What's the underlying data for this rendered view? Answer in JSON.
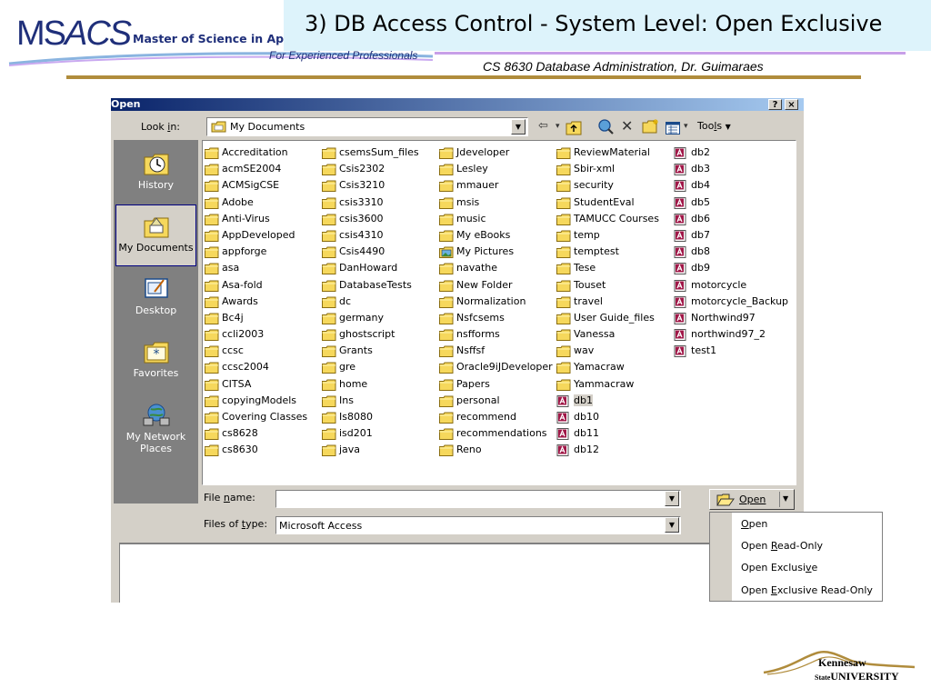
{
  "logo": {
    "ms": "MS",
    "acs": "ACS",
    "subtitle": "Master of Science in App",
    "tagline": "For Experienced Professionals"
  },
  "slide": {
    "title": "3) DB Access Control - System Level: Open Exclusive",
    "course": "CS 8630 Database Administration, Dr. Guimaraes",
    "footer_logo_line1": "Kennesaw",
    "footer_logo_line2a": "State",
    "footer_logo_line2b": "UNIVERSITY"
  },
  "dialog": {
    "title": "Open",
    "help_btn": "?",
    "close_btn": "×",
    "look_in_label_pre": "Look ",
    "look_in_label_u": "i",
    "look_in_label_post": "n:",
    "look_in_value": "My Documents",
    "tools_pre": "Too",
    "tools_u": "l",
    "tools_post": "s",
    "places": [
      {
        "label": "History",
        "icon": "history-icon"
      },
      {
        "label": "My Documents",
        "icon": "my-documents-icon",
        "selected": true
      },
      {
        "label": "Desktop",
        "icon": "desktop-icon"
      },
      {
        "label": "Favorites",
        "icon": "favorites-icon"
      },
      {
        "label": "My Network Places",
        "icon": "network-places-icon"
      }
    ],
    "columns": [
      [
        {
          "name": "Accreditation",
          "type": "folder"
        },
        {
          "name": "acmSE2004",
          "type": "folder"
        },
        {
          "name": "ACMSigCSE",
          "type": "folder"
        },
        {
          "name": "Adobe",
          "type": "folder"
        },
        {
          "name": "Anti-Virus",
          "type": "folder"
        },
        {
          "name": "AppDeveloped",
          "type": "folder"
        },
        {
          "name": "appforge",
          "type": "folder"
        },
        {
          "name": "asa",
          "type": "folder"
        },
        {
          "name": "Asa-fold",
          "type": "folder"
        },
        {
          "name": "Awards",
          "type": "folder"
        },
        {
          "name": "Bc4j",
          "type": "folder"
        },
        {
          "name": "ccli2003",
          "type": "folder"
        },
        {
          "name": "ccsc",
          "type": "folder"
        },
        {
          "name": "ccsc2004",
          "type": "folder"
        },
        {
          "name": "CITSA",
          "type": "folder"
        },
        {
          "name": "copyingModels",
          "type": "folder"
        },
        {
          "name": "Covering Classes",
          "type": "folder"
        },
        {
          "name": "cs8628",
          "type": "folder"
        },
        {
          "name": "cs8630",
          "type": "folder"
        }
      ],
      [
        {
          "name": "csemsSum_files",
          "type": "folder"
        },
        {
          "name": "Csis2302",
          "type": "folder"
        },
        {
          "name": "Csis3210",
          "type": "folder"
        },
        {
          "name": "csis3310",
          "type": "folder"
        },
        {
          "name": "csis3600",
          "type": "folder"
        },
        {
          "name": "csis4310",
          "type": "folder"
        },
        {
          "name": "Csis4490",
          "type": "folder"
        },
        {
          "name": "DanHoward",
          "type": "folder"
        },
        {
          "name": "DatabaseTests",
          "type": "folder"
        },
        {
          "name": "dc",
          "type": "folder"
        },
        {
          "name": "germany",
          "type": "folder"
        },
        {
          "name": "ghostscript",
          "type": "folder"
        },
        {
          "name": "Grants",
          "type": "folder"
        },
        {
          "name": "gre",
          "type": "folder"
        },
        {
          "name": "home",
          "type": "folder"
        },
        {
          "name": "Ins",
          "type": "folder"
        },
        {
          "name": "Is8080",
          "type": "folder"
        },
        {
          "name": "isd201",
          "type": "folder"
        },
        {
          "name": "java",
          "type": "folder"
        }
      ],
      [
        {
          "name": "Jdeveloper",
          "type": "folder"
        },
        {
          "name": "Lesley",
          "type": "folder"
        },
        {
          "name": "mmauer",
          "type": "folder"
        },
        {
          "name": "msis",
          "type": "folder"
        },
        {
          "name": "music",
          "type": "folder"
        },
        {
          "name": "My eBooks",
          "type": "folder"
        },
        {
          "name": "My Pictures",
          "type": "pictures"
        },
        {
          "name": "navathe",
          "type": "folder"
        },
        {
          "name": "New Folder",
          "type": "folder"
        },
        {
          "name": "Normalization",
          "type": "folder"
        },
        {
          "name": "Nsfcsems",
          "type": "folder"
        },
        {
          "name": "nsfforms",
          "type": "folder"
        },
        {
          "name": "Nsffsf",
          "type": "folder"
        },
        {
          "name": "Oracle9iJDeveloper",
          "type": "folder"
        },
        {
          "name": "Papers",
          "type": "folder"
        },
        {
          "name": "personal",
          "type": "folder"
        },
        {
          "name": "recommend",
          "type": "folder"
        },
        {
          "name": "recommendations",
          "type": "folder"
        },
        {
          "name": "Reno",
          "type": "folder"
        }
      ],
      [
        {
          "name": "ReviewMaterial",
          "type": "folder"
        },
        {
          "name": "Sbir-xml",
          "type": "folder"
        },
        {
          "name": "security",
          "type": "folder"
        },
        {
          "name": "StudentEval",
          "type": "folder"
        },
        {
          "name": "TAMUCC Courses",
          "type": "folder"
        },
        {
          "name": "temp",
          "type": "folder"
        },
        {
          "name": "temptest",
          "type": "folder"
        },
        {
          "name": "Tese",
          "type": "folder"
        },
        {
          "name": "Touset",
          "type": "folder"
        },
        {
          "name": "travel",
          "type": "folder"
        },
        {
          "name": "User Guide_files",
          "type": "folder"
        },
        {
          "name": "Vanessa",
          "type": "folder"
        },
        {
          "name": "wav",
          "type": "folder"
        },
        {
          "name": "Yamacraw",
          "type": "folder"
        },
        {
          "name": "Yammacraw",
          "type": "folder"
        },
        {
          "name": "db1",
          "type": "access",
          "selected": true
        },
        {
          "name": "db10",
          "type": "access"
        },
        {
          "name": "db11",
          "type": "access"
        },
        {
          "name": "db12",
          "type": "access"
        }
      ],
      [
        {
          "name": "db2",
          "type": "access"
        },
        {
          "name": "db3",
          "type": "access"
        },
        {
          "name": "db4",
          "type": "access"
        },
        {
          "name": "db5",
          "type": "access"
        },
        {
          "name": "db6",
          "type": "access"
        },
        {
          "name": "db7",
          "type": "access"
        },
        {
          "name": "db8",
          "type": "access"
        },
        {
          "name": "db9",
          "type": "access"
        },
        {
          "name": "motorcycle",
          "type": "access"
        },
        {
          "name": "motorcycle_Backup",
          "type": "access"
        },
        {
          "name": "Northwind97",
          "type": "access"
        },
        {
          "name": "northwind97_2",
          "type": "access"
        },
        {
          "name": "test1",
          "type": "access"
        }
      ]
    ],
    "file_name_label_pre": "File ",
    "file_name_label_u": "n",
    "file_name_label_post": "ame:",
    "file_name_value": "",
    "files_of_type_label_pre": "Files of ",
    "files_of_type_label_u": "t",
    "files_of_type_label_post": "ype:",
    "files_of_type_value": "Microsoft Access",
    "open_button": "Open",
    "open_menu": [
      {
        "pre": "",
        "u": "O",
        "post": "pen"
      },
      {
        "pre": "Open ",
        "u": "R",
        "post": "ead-Only"
      },
      {
        "pre": "Open Exclusi",
        "u": "v",
        "post": "e"
      },
      {
        "pre": "Open ",
        "u": "E",
        "post": "xclusive Read-Only"
      }
    ]
  },
  "colors": {
    "title_bar_bg": "#ddf3fb",
    "accent_line": "#c8a0e8",
    "gold_rule": "#b08c3c",
    "dialog_face": "#d4d0c8",
    "title_gradient_start": "#0a246a",
    "folder_yellow": "#f6d85c",
    "access_icon": "#a01848"
  }
}
